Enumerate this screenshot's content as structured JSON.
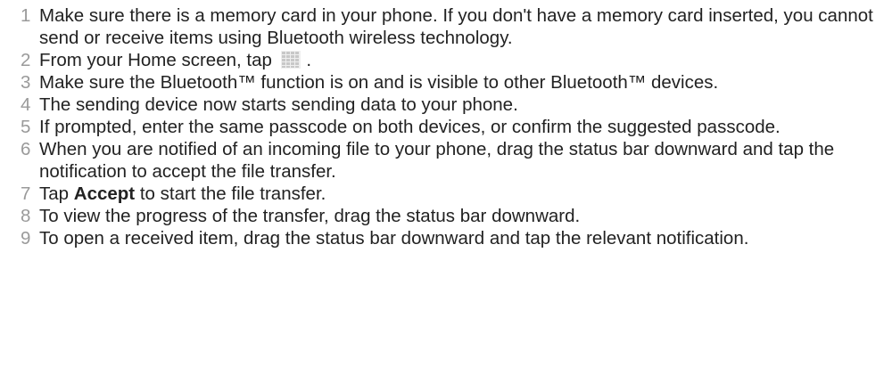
{
  "steps": [
    {
      "number": "1",
      "text": "Make sure there is a memory card in your phone. If you don't have a memory card inserted, you cannot send or receive items using Bluetooth wireless technology."
    },
    {
      "number": "2",
      "text_before": "From your Home screen, tap",
      "icon": "apps-grid-icon",
      "text_after": "."
    },
    {
      "number": "3",
      "text": "Make sure the Bluetooth™ function is on and is visible to other Bluetooth™ devices."
    },
    {
      "number": "4",
      "text": "The sending device now starts sending data to your phone."
    },
    {
      "number": "5",
      "text": "If prompted, enter the same passcode on both devices, or confirm the suggested passcode."
    },
    {
      "number": "6",
      "text": "When you are notified of an incoming file to your phone, drag the status bar downward and tap the notification to accept the file transfer."
    },
    {
      "number": "7",
      "text_before": "Tap",
      "bold": "Accept",
      "text_after": "to start the file transfer."
    },
    {
      "number": "8",
      "text": "To view the progress of the transfer, drag the status bar downward."
    },
    {
      "number": "9",
      "text": "To open a received item, drag the status bar downward and tap the relevant notification."
    }
  ],
  "colors": {
    "text": "#222222",
    "step_number": "#9a9a9a",
    "icon_grid": "#c8c8c8"
  }
}
